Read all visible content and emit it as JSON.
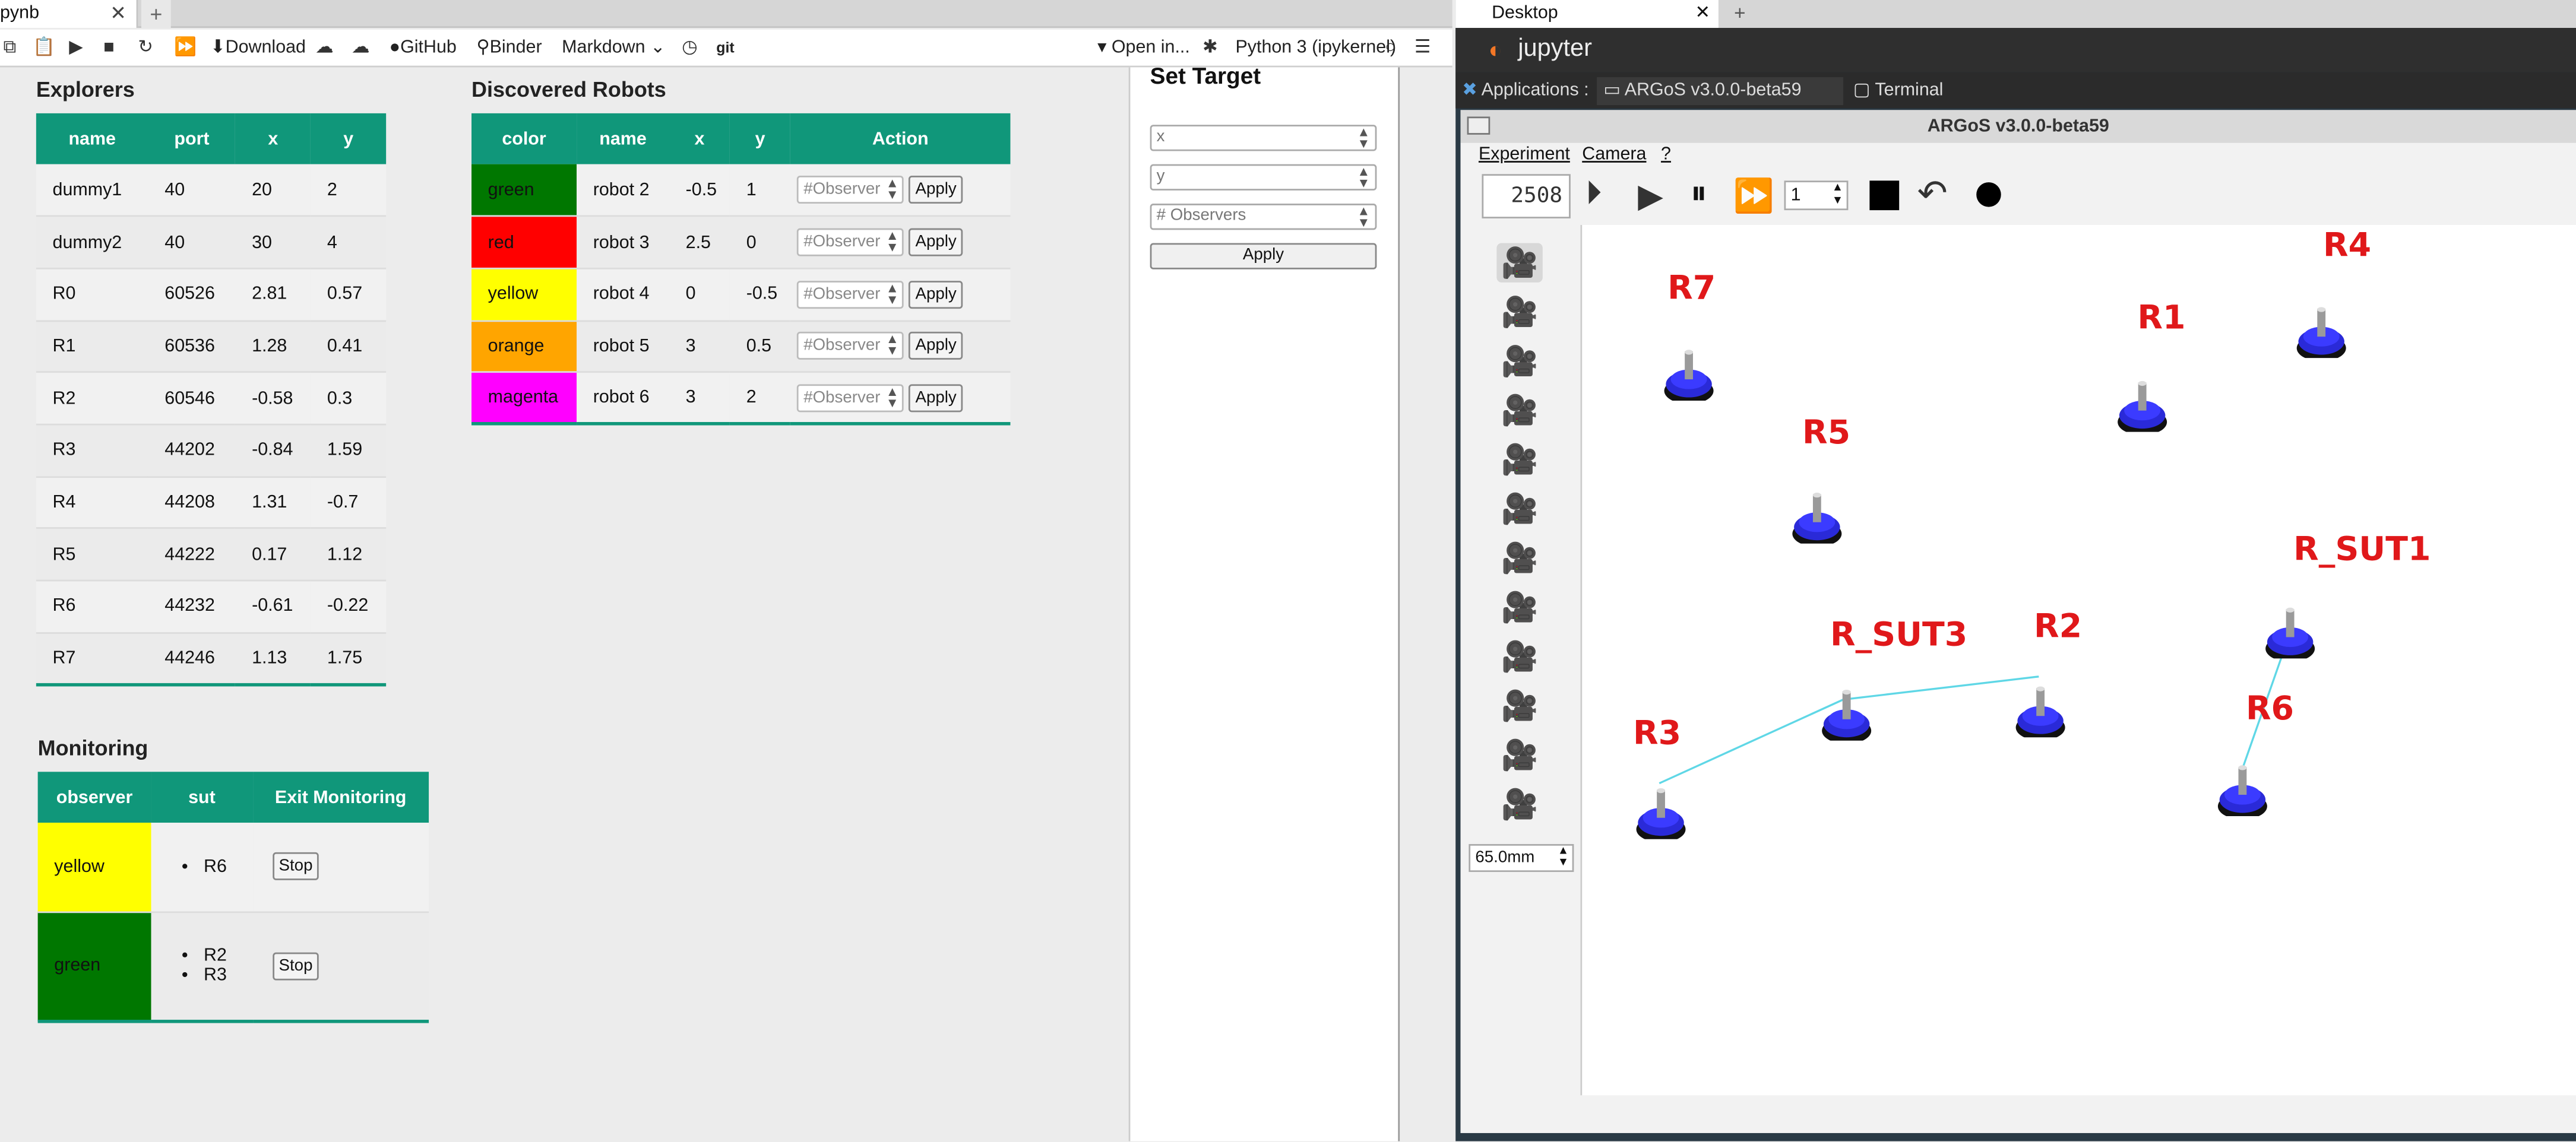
{
  "left_tab": {
    "title": "pynb",
    "close": "✕",
    "add": "+"
  },
  "toolbar": {
    "download": "Download",
    "github": "GitHub",
    "binder": "Binder",
    "cell_type": "Markdown",
    "git": "git",
    "open_in": "Open in...",
    "kernel": "Python 3 (ipykernel)"
  },
  "explorers": {
    "title": "Explorers",
    "headers": [
      "name",
      "port",
      "x",
      "y"
    ],
    "rows": [
      [
        "dummy1",
        "40",
        "20",
        "2"
      ],
      [
        "dummy2",
        "40",
        "30",
        "4"
      ],
      [
        "R0",
        "60526",
        "2.81",
        "0.57"
      ],
      [
        "R1",
        "60536",
        "1.28",
        "0.41"
      ],
      [
        "R2",
        "60546",
        "-0.58",
        "0.3"
      ],
      [
        "R3",
        "44202",
        "-0.84",
        "1.59"
      ],
      [
        "R4",
        "44208",
        "1.31",
        "-0.7"
      ],
      [
        "R5",
        "44222",
        "0.17",
        "1.12"
      ],
      [
        "R6",
        "44232",
        "-0.61",
        "-0.22"
      ],
      [
        "R7",
        "44246",
        "1.13",
        "1.75"
      ]
    ]
  },
  "discovered": {
    "title": "Discovered Robots",
    "headers": [
      "color",
      "name",
      "x",
      "y",
      "Action"
    ],
    "placeholder": "#Observer",
    "apply": "Apply",
    "rows": [
      {
        "color": "green",
        "bg": "#007700",
        "name": "robot 2",
        "x": "-0.5",
        "y": "1"
      },
      {
        "color": "red",
        "bg": "#ff0000",
        "name": "robot 3",
        "x": "2.5",
        "y": "0"
      },
      {
        "color": "yellow",
        "bg": "#ffff00",
        "name": "robot 4",
        "x": "0",
        "y": "-0.5"
      },
      {
        "color": "orange",
        "bg": "#ffa500",
        "name": "robot 5",
        "x": "3",
        "y": "0.5"
      },
      {
        "color": "magenta",
        "bg": "#ff00ff",
        "name": "robot 6",
        "x": "3",
        "y": "2"
      }
    ]
  },
  "monitoring": {
    "title": "Monitoring",
    "headers": [
      "observer",
      "sut",
      "Exit Monitoring"
    ],
    "stop": "Stop",
    "rows": [
      {
        "observer": "yellow",
        "bg": "#ffff00",
        "sut": [
          "R6"
        ]
      },
      {
        "observer": "green",
        "bg": "#007700",
        "sut": [
          "R2",
          "R3"
        ]
      }
    ]
  },
  "set_target": {
    "title": "Set Target",
    "x_placeholder": "x",
    "y_placeholder": "y",
    "obs_placeholder": "# Observers",
    "apply": "Apply"
  },
  "desktop": {
    "tab": "Desktop",
    "brand": "jupyter",
    "tasks": [
      "Applications :",
      "ARGoS v3.0.0-beta59",
      "Terminal"
    ]
  },
  "argos": {
    "title": "ARGoS v3.0.0-beta59",
    "menu": [
      "Experiment",
      "Camera",
      "?"
    ],
    "step": "2508",
    "speed": "1",
    "zoom": "65.0mm",
    "robots": [
      {
        "label": "R7"
      },
      {
        "label": "R4"
      },
      {
        "label": "R1"
      },
      {
        "label": "R5"
      },
      {
        "label": "R_SUT1"
      },
      {
        "label": "R_SUT3"
      },
      {
        "label": "R2"
      },
      {
        "label": "R6"
      },
      {
        "label": "R3"
      }
    ]
  }
}
